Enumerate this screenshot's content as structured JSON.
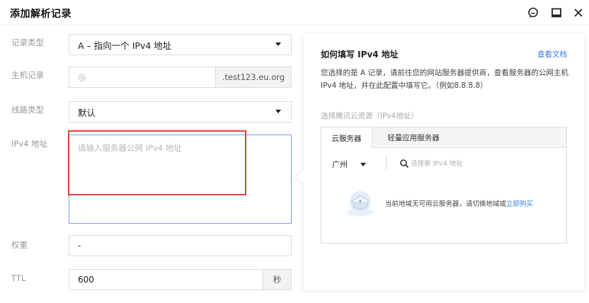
{
  "dialog": {
    "title": "添加解析记录"
  },
  "form": {
    "record_type": {
      "label": "记录类型",
      "value": "A – 指向一个 IPv4 地址"
    },
    "host": {
      "label": "主机记录",
      "placeholder": "@",
      "suffix": ".test123.eu.org"
    },
    "line_type": {
      "label": "线路类型",
      "value": "默认"
    },
    "ipv4": {
      "label": "IPv4 地址",
      "placeholder": "请输入服务器公网 IPv4 地址"
    },
    "weight": {
      "label": "权重",
      "value": "-"
    },
    "ttl": {
      "label": "TTL",
      "value": "600",
      "unit": "秒"
    }
  },
  "help_panel": {
    "title": "如何填写 IPv4 地址",
    "doc_link": "查看文档",
    "description": "您选择的是 A 记录，请前往您的网站服务器提供商，查看服务器的公网主机 IPv4 地址，并在此配置中填写它。（例如8.8.8.8）",
    "section_label": "选择腾讯云资源（IPv4地址）",
    "tabs": [
      {
        "label": "云服务器",
        "active": true
      },
      {
        "label": "轻量应用服务器",
        "active": false
      }
    ],
    "region": "广州",
    "search_placeholder": "请搜索 IPv4 地址",
    "empty_text": "当前地域无可用云服务器，请切换地域或",
    "empty_link": "立即购买"
  },
  "colors": {
    "accent": "#3b7ddd",
    "highlight": "#d9453a",
    "active_border": "#7f9fda"
  },
  "icons": {
    "titlebar": [
      "feedback-icon",
      "minimize-icon",
      "close-icon"
    ]
  }
}
